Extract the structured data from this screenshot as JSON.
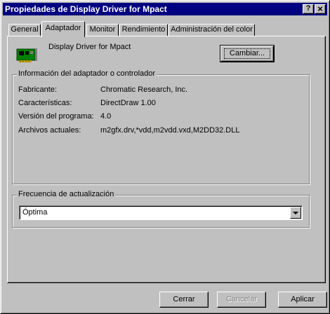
{
  "window": {
    "title": "Propiedades de Display Driver for Mpact",
    "help_glyph": "?",
    "close_glyph": "×"
  },
  "tabs": [
    {
      "label": "General",
      "active": false
    },
    {
      "label": "Adaptador",
      "active": true
    },
    {
      "label": "Monitor",
      "active": false
    },
    {
      "label": "Rendimiento",
      "active": false
    },
    {
      "label": "Administración del color",
      "active": false
    }
  ],
  "adapter": {
    "icon": "display-adapter-card-icon",
    "name": "Display Driver for Mpact",
    "change_button": "Cambiar..."
  },
  "info_group": {
    "title": "Información del adaptador o controlador",
    "rows": [
      {
        "label": "Fabricante:",
        "value": "Chromatic Research, Inc."
      },
      {
        "label": "Características:",
        "value": "DirectDraw 1.00"
      },
      {
        "label": "Versión del programa:",
        "value": "4.0"
      },
      {
        "label": "Archivos actuales:",
        "value": "m2gfx.drv,*vdd,m2vdd.vxd,M2DD32.DLL"
      }
    ]
  },
  "refresh_group": {
    "title": "Frecuencia de actualización",
    "selected": "Óptima"
  },
  "footer": {
    "ok": "Cerrar",
    "cancel": "Cancelar",
    "apply": "Aplicar"
  },
  "colors": {
    "titlebar": "#000080",
    "face": "#c0c0c0",
    "card_green": "#008000"
  }
}
